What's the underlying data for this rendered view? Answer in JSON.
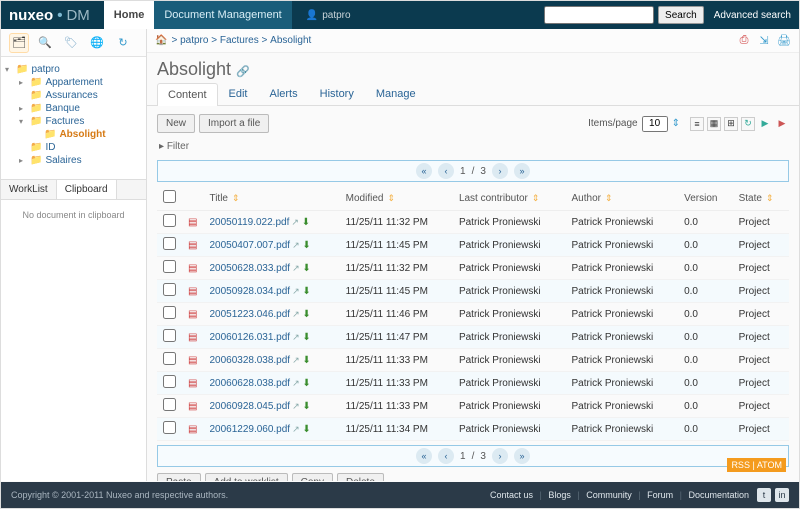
{
  "brand": {
    "n1": "nuxeo",
    "dot": "•",
    "n2": "DM"
  },
  "toptabs": {
    "home": "Home",
    "dm": "Document Management"
  },
  "user": "patpro",
  "search": {
    "btn": "Search",
    "adv": "Advanced search",
    "val": ""
  },
  "tree": {
    "root": "patpro",
    "items": [
      "Appartement",
      "Assurances",
      "Banque",
      "Factures",
      "ID",
      "Salaires"
    ],
    "factures_child": "Absolight"
  },
  "worklist": {
    "tab1": "WorkList",
    "tab2": "Clipboard",
    "msg": "No document in clipboard"
  },
  "breadcrumb": {
    "a": "patpro",
    "b": "Factures",
    "c": "Absolight",
    "sep": ">"
  },
  "page": {
    "title": "Absolight"
  },
  "tabs": {
    "content": "Content",
    "edit": "Edit",
    "alerts": "Alerts",
    "history": "History",
    "manage": "Manage"
  },
  "actions": {
    "new": "New",
    "import": "Import a file",
    "paste": "Paste",
    "addwl": "Add to worklist",
    "copy": "Copy",
    "delete": "Delete"
  },
  "ipp": {
    "label": "Items/page",
    "val": "10"
  },
  "filter": "Filter",
  "pager": {
    "cur": "1",
    "total": "3",
    "sep": "/"
  },
  "cols": {
    "title": "Title",
    "modified": "Modified",
    "lastc": "Last contributor",
    "author": "Author",
    "version": "Version",
    "state": "State"
  },
  "rows": [
    {
      "f": "20050119.022.pdf",
      "m": "11/25/11 11:32 PM",
      "c": "Patrick Proniewski",
      "a": "Patrick Proniewski",
      "v": "0.0",
      "s": "Project"
    },
    {
      "f": "20050407.007.pdf",
      "m": "11/25/11 11:45 PM",
      "c": "Patrick Proniewski",
      "a": "Patrick Proniewski",
      "v": "0.0",
      "s": "Project"
    },
    {
      "f": "20050628.033.pdf",
      "m": "11/25/11 11:32 PM",
      "c": "Patrick Proniewski",
      "a": "Patrick Proniewski",
      "v": "0.0",
      "s": "Project"
    },
    {
      "f": "20050928.034.pdf",
      "m": "11/25/11 11:45 PM",
      "c": "Patrick Proniewski",
      "a": "Patrick Proniewski",
      "v": "0.0",
      "s": "Project"
    },
    {
      "f": "20051223.046.pdf",
      "m": "11/25/11 11:46 PM",
      "c": "Patrick Proniewski",
      "a": "Patrick Proniewski",
      "v": "0.0",
      "s": "Project"
    },
    {
      "f": "20060126.031.pdf",
      "m": "11/25/11 11:47 PM",
      "c": "Patrick Proniewski",
      "a": "Patrick Proniewski",
      "v": "0.0",
      "s": "Project"
    },
    {
      "f": "20060328.038.pdf",
      "m": "11/25/11 11:33 PM",
      "c": "Patrick Proniewski",
      "a": "Patrick Proniewski",
      "v": "0.0",
      "s": "Project"
    },
    {
      "f": "20060628.038.pdf",
      "m": "11/25/11 11:33 PM",
      "c": "Patrick Proniewski",
      "a": "Patrick Proniewski",
      "v": "0.0",
      "s": "Project"
    },
    {
      "f": "20060928.045.pdf",
      "m": "11/25/11 11:33 PM",
      "c": "Patrick Proniewski",
      "a": "Patrick Proniewski",
      "v": "0.0",
      "s": "Project"
    },
    {
      "f": "20061229.060.pdf",
      "m": "11/25/11 11:34 PM",
      "c": "Patrick Proniewski",
      "a": "Patrick Proniewski",
      "v": "0.0",
      "s": "Project"
    }
  ],
  "rss": {
    "r": "RSS",
    "a": "ATOM",
    "sep": "|"
  },
  "footer": {
    "copy": "Copyright © 2001-2011 Nuxeo and respective authors.",
    "links": [
      "Contact us",
      "Blogs",
      "Community",
      "Forum",
      "Documentation"
    ]
  }
}
